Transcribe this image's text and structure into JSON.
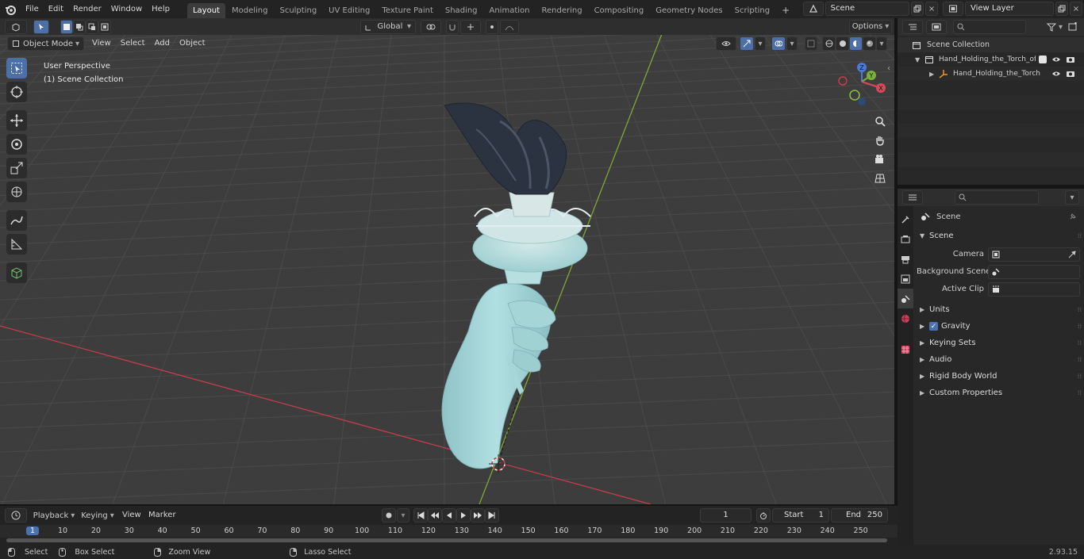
{
  "topbar": {
    "menus": [
      "File",
      "Edit",
      "Render",
      "Window",
      "Help"
    ],
    "workspaces": [
      "Layout",
      "Modeling",
      "Sculpting",
      "UV Editing",
      "Texture Paint",
      "Shading",
      "Animation",
      "Rendering",
      "Compositing",
      "Geometry Nodes",
      "Scripting"
    ],
    "active_workspace": "Layout",
    "add_tab_label": "+",
    "scene_name": "Scene",
    "view_layer_name": "View Layer"
  },
  "viewport_header": {
    "transform_orientation": "Global",
    "options_label": "Options",
    "mode": "Object Mode",
    "menus": [
      "View",
      "Select",
      "Add",
      "Object"
    ]
  },
  "viewport": {
    "overlay_line1": "User Perspective",
    "overlay_line2": "(1) Scene Collection",
    "gizmo_axes": {
      "x": "X",
      "y": "Y",
      "z": "Z"
    },
    "colors": {
      "background": "#3d3d3d",
      "grid": "#4a4a4a",
      "x_axis": "#c43d4d",
      "y_axis": "#7ea832",
      "model": "#a6d7d9",
      "flame": "#2b3340"
    }
  },
  "outliner": {
    "root": "Scene Collection",
    "items": [
      {
        "label": "Hand_Holding_the_Torch_of_L"
      },
      {
        "label": "Hand_Holding_the_Torch_"
      }
    ]
  },
  "properties": {
    "context_title": "Scene",
    "panel_title": "Scene",
    "fields": [
      {
        "label": "Camera",
        "value": ""
      },
      {
        "label": "Background Scene",
        "value": ""
      },
      {
        "label": "Active Clip",
        "value": ""
      }
    ],
    "subpanels": [
      "Units",
      "Gravity",
      "Keying Sets",
      "Audio",
      "Rigid Body World",
      "Custom Properties"
    ],
    "gravity_enabled": true
  },
  "timeline": {
    "menus": [
      "Playback",
      "Keying",
      "View",
      "Marker"
    ],
    "current_frame": "1",
    "start_label": "Start",
    "start_value": "1",
    "end_label": "End",
    "end_value": "250",
    "ticks": [
      "1",
      "10",
      "20",
      "30",
      "40",
      "50",
      "60",
      "70",
      "80",
      "90",
      "100",
      "110",
      "120",
      "130",
      "140",
      "150",
      "160",
      "170",
      "180",
      "190",
      "200",
      "210",
      "220",
      "230",
      "240",
      "250"
    ]
  },
  "statusbar": {
    "items": [
      "Select",
      "Box Select",
      "Zoom View",
      "Lasso Select"
    ],
    "version": "2.93.15"
  }
}
